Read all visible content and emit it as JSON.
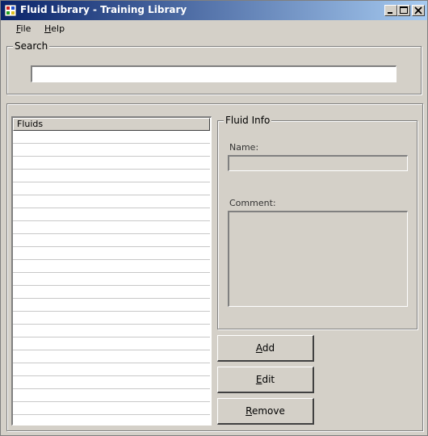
{
  "window": {
    "title": "Fluid Library - Training Library",
    "controls": {
      "minimize": "minimize",
      "maximize": "maximize",
      "close": "close"
    }
  },
  "menu": {
    "items": [
      {
        "accel": "F",
        "rest": "ile"
      },
      {
        "accel": "H",
        "rest": "elp"
      }
    ]
  },
  "search": {
    "legend": "Search",
    "value": ""
  },
  "fluids": {
    "header": "Fluids",
    "rows": []
  },
  "fluid_info": {
    "legend": "Fluid Info",
    "name_label": "Name:",
    "name_value": "",
    "comment_label": "Comment:",
    "comment_value": ""
  },
  "buttons": {
    "add": {
      "accel": "A",
      "rest": "dd"
    },
    "edit": {
      "accel": "E",
      "rest": "dit"
    },
    "remove": {
      "accel": "R",
      "rest": "emove"
    }
  },
  "colors": {
    "titlebar_start": "#0a246a",
    "titlebar_end": "#a6caf0",
    "face": "#d4d0c8"
  }
}
